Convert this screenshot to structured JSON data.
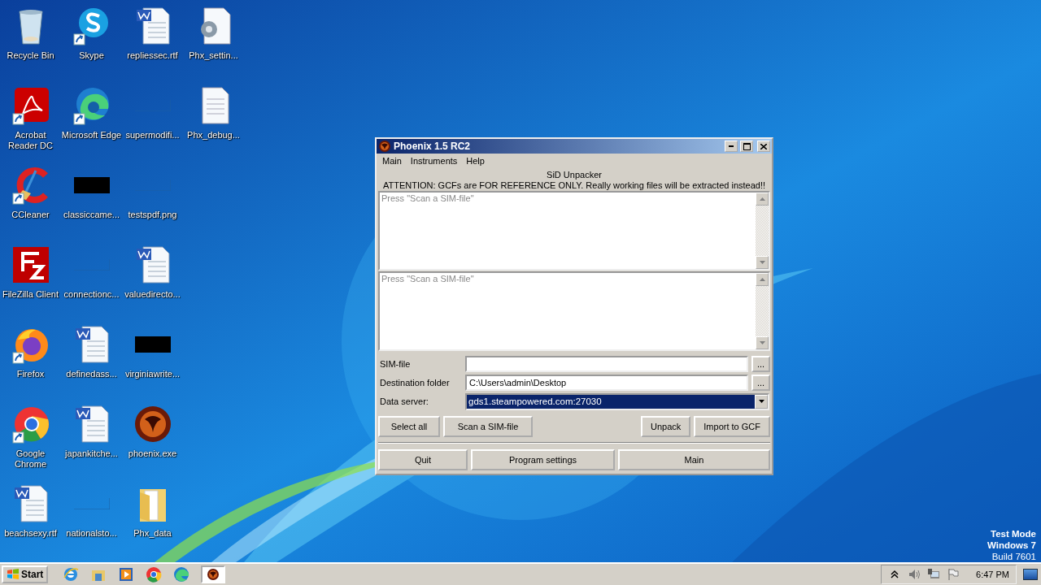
{
  "desktop": {
    "icons": [
      {
        "label": "Recycle Bin",
        "kind": "recycle",
        "shortcut": false
      },
      {
        "label": "Acrobat Reader DC",
        "kind": "acrobat",
        "shortcut": true
      },
      {
        "label": "CCleaner",
        "kind": "ccleaner",
        "shortcut": true
      },
      {
        "label": "FileZilla Client",
        "kind": "filezilla",
        "shortcut": false
      },
      {
        "label": "Firefox",
        "kind": "firefox",
        "shortcut": true
      },
      {
        "label": "Google Chrome",
        "kind": "chrome",
        "shortcut": true
      },
      {
        "label": "beachsexy.rtf",
        "kind": "word",
        "shortcut": false
      },
      {
        "label": "Skype",
        "kind": "skype",
        "shortcut": true
      },
      {
        "label": "Microsoft Edge",
        "kind": "edge",
        "shortcut": true
      },
      {
        "label": "classiccame...",
        "kind": "dark",
        "shortcut": false
      },
      {
        "label": "connectionc...",
        "kind": "blank",
        "shortcut": false
      },
      {
        "label": "definedass...",
        "kind": "word",
        "shortcut": false
      },
      {
        "label": "japankitche...",
        "kind": "word",
        "shortcut": false
      },
      {
        "label": "nationalsto...",
        "kind": "blank",
        "shortcut": false
      },
      {
        "label": "repliessec.rtf",
        "kind": "word",
        "shortcut": false
      },
      {
        "label": "supermodifi...",
        "kind": "blank",
        "shortcut": false
      },
      {
        "label": "testspdf.png",
        "kind": "blank",
        "shortcut": false
      },
      {
        "label": "valuedirecto...",
        "kind": "word",
        "shortcut": false
      },
      {
        "label": "virginiawrite...",
        "kind": "dark",
        "shortcut": false
      },
      {
        "label": "phoenix.exe",
        "kind": "phoenix",
        "shortcut": false
      },
      {
        "label": "Phx_data",
        "kind": "folder",
        "shortcut": false
      },
      {
        "label": "Phx_settin...",
        "kind": "settings",
        "shortcut": false
      },
      {
        "label": "Phx_debug...",
        "kind": "text",
        "shortcut": false
      }
    ]
  },
  "window": {
    "title": "Phoenix 1.5 RC2",
    "menu": [
      "Main",
      "Instruments",
      "Help"
    ],
    "heading": "SiD Unpacker",
    "notice": "ATTENTION: GCFs are FOR REFERENCE ONLY. Really working files will be extracted instead!!",
    "lists": [
      {
        "placeholder": "Press \"Scan a SIM-file\""
      },
      {
        "placeholder": "Press \"Scan a SIM-file\""
      }
    ],
    "fields": [
      {
        "label": "SIM-file",
        "kind": "path",
        "button": "..."
      },
      {
        "label": "Destination folder",
        "kind": "path",
        "value": "C:\\Users\\admin\\Desktop",
        "button": "..."
      },
      {
        "label": "Data server:",
        "kind": "combo",
        "value": "gds1.steampowered.com:27030",
        "focused": true
      }
    ],
    "actions_left": [
      "Select all",
      "Scan a SIM-file"
    ],
    "actions_right": [
      "Unpack",
      "Import to GCF"
    ],
    "footer_buttons": [
      "Quit",
      "Program settings",
      "Main"
    ]
  },
  "system_notice": [
    "Test Mode",
    "Windows 7",
    "Build 7601"
  ],
  "taskbar": {
    "start": "Start",
    "quick_launch": [
      {
        "kind": "ie"
      },
      {
        "kind": "explorer"
      },
      {
        "kind": "media"
      },
      {
        "kind": "chrome"
      },
      {
        "kind": "edge"
      }
    ],
    "tasks": [
      {
        "kind": "phoenix",
        "selected": true
      }
    ],
    "tray": [
      {
        "kind": "arrow"
      },
      {
        "kind": "speaker"
      },
      {
        "kind": "network"
      },
      {
        "kind": "flag"
      }
    ],
    "clock": "6:47 PM"
  }
}
